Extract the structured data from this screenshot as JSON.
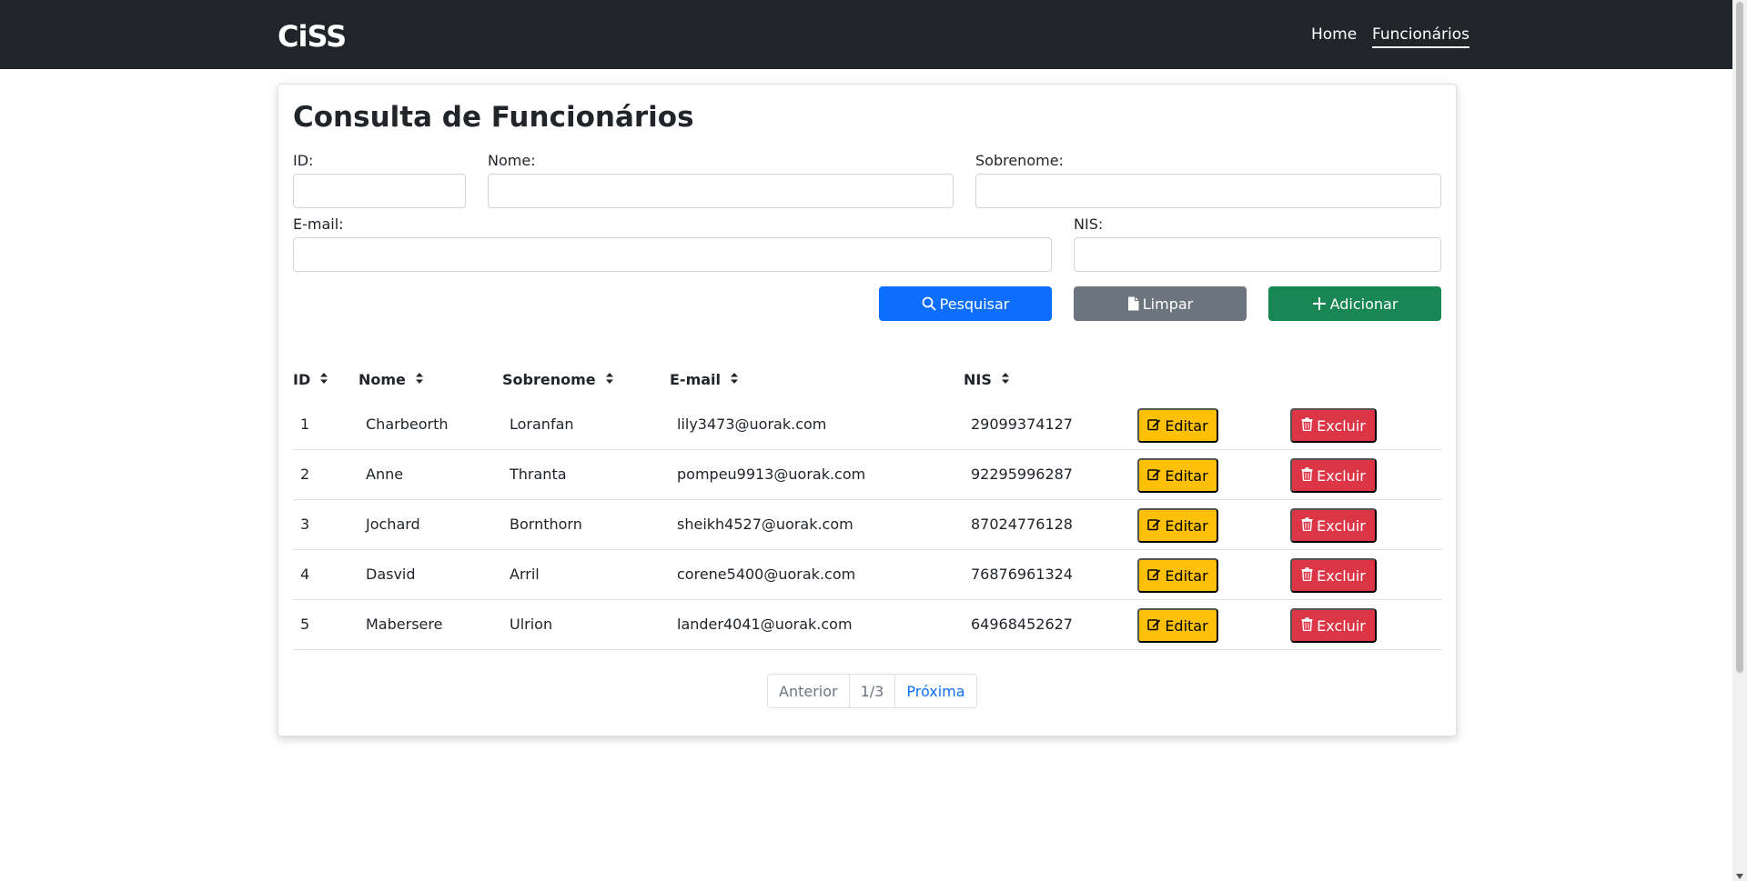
{
  "brand": {
    "logo_text": "CiSS"
  },
  "nav": {
    "home_label": "Home",
    "funcionarios_label": "Funcionários"
  },
  "page": {
    "title": "Consulta de Funcionários"
  },
  "form": {
    "id_label": "ID:",
    "id_value": "",
    "nome_label": "Nome:",
    "nome_value": "",
    "sobrenome_label": "Sobrenome:",
    "sobrenome_value": "",
    "email_label": "E-mail:",
    "email_value": "",
    "nis_label": "NIS:",
    "nis_value": ""
  },
  "actions": {
    "search_label": "Pesquisar",
    "clear_label": "Limpar",
    "add_label": "Adicionar"
  },
  "table": {
    "columns": [
      "ID",
      "Nome",
      "Sobrenome",
      "E-mail",
      "NIS"
    ],
    "rows": [
      {
        "id": "1",
        "nome": "Charbeorth",
        "sobrenome": "Loranfan",
        "email": "lily3473@uorak.com",
        "nis": "29099374127"
      },
      {
        "id": "2",
        "nome": "Anne",
        "sobrenome": "Thranta",
        "email": "pompeu9913@uorak.com",
        "nis": "92295996287"
      },
      {
        "id": "3",
        "nome": "Jochard",
        "sobrenome": "Bornthorn",
        "email": "sheikh4527@uorak.com",
        "nis": "87024776128"
      },
      {
        "id": "4",
        "nome": "Dasvid",
        "sobrenome": "Arril",
        "email": "corene5400@uorak.com",
        "nis": "76876961324"
      },
      {
        "id": "5",
        "nome": "Mabersere",
        "sobrenome": "Ulrion",
        "email": "lander4041@uorak.com",
        "nis": "64968452627"
      }
    ],
    "edit_label": "Editar",
    "delete_label": "Excluir"
  },
  "pagination": {
    "prev_label": "Anterior",
    "current": "1/3",
    "next_label": "Próxima"
  },
  "colors": {
    "navbar": "#212529",
    "primary": "#0d6efd",
    "secondary": "#6c757d",
    "success": "#198754",
    "warning": "#ffc107",
    "danger": "#dc3545"
  }
}
